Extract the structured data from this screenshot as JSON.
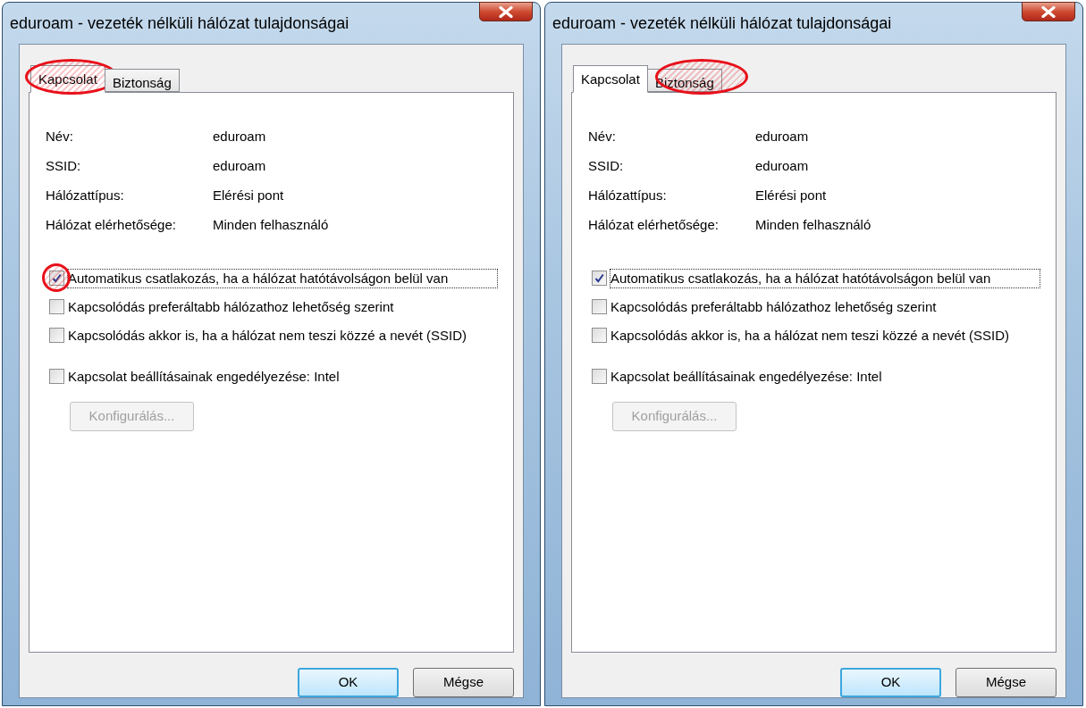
{
  "dialogs": [
    {
      "title": "eduroam - vezeték nélküli hálózat tulajdonságai",
      "tabs": [
        {
          "label": "Kapcsolat",
          "selected": true,
          "highlighted": true
        },
        {
          "label": "Biztonság",
          "selected": false,
          "highlighted": false
        }
      ],
      "fields": [
        {
          "label": "Név:",
          "value": "eduroam"
        },
        {
          "label": "SSID:",
          "value": "eduroam"
        },
        {
          "label": "Hálózattípus:",
          "value": "Elérési pont"
        },
        {
          "label": "Hálózat elérhetősége:",
          "value": "Minden felhasználó"
        }
      ],
      "checkboxes": [
        {
          "label": "Automatikus csatlakozás, ha a hálózat hatótávolságon belül van",
          "checked": true,
          "focused": true,
          "highlighted": true
        },
        {
          "label": "Kapcsolódás preferáltabb hálózathoz lehetőség szerint",
          "checked": false,
          "focused": false,
          "highlighted": false
        },
        {
          "label": "Kapcsolódás akkor is, ha a hálózat nem teszi közzé a nevét (SSID)",
          "checked": false,
          "focused": false,
          "highlighted": false
        },
        {
          "label": "Kapcsolat beállításainak engedélyezése: Intel",
          "checked": false,
          "focused": false,
          "highlighted": false
        }
      ],
      "configure_button": {
        "label": "Konfigurálás...",
        "disabled": true
      },
      "buttons": [
        {
          "label": "OK",
          "default": true
        },
        {
          "label": "Mégse",
          "default": false
        }
      ]
    },
    {
      "title": "eduroam - vezeték nélküli hálózat tulajdonságai",
      "tabs": [
        {
          "label": "Kapcsolat",
          "selected": true,
          "highlighted": false
        },
        {
          "label": "Biztonság",
          "selected": false,
          "highlighted": true
        }
      ],
      "fields": [
        {
          "label": "Név:",
          "value": "eduroam"
        },
        {
          "label": "SSID:",
          "value": "eduroam"
        },
        {
          "label": "Hálózattípus:",
          "value": "Elérési pont"
        },
        {
          "label": "Hálózat elérhetősége:",
          "value": "Minden felhasználó"
        }
      ],
      "checkboxes": [
        {
          "label": "Automatikus csatlakozás, ha a hálózat hatótávolságon belül van",
          "checked": true,
          "focused": true,
          "highlighted": false
        },
        {
          "label": "Kapcsolódás preferáltabb hálózathoz lehetőség szerint",
          "checked": false,
          "focused": false,
          "highlighted": false
        },
        {
          "label": "Kapcsolódás akkor is, ha a hálózat nem teszi közzé a nevét (SSID)",
          "checked": false,
          "focused": false,
          "highlighted": false
        },
        {
          "label": "Kapcsolat beállításainak engedélyezése: Intel",
          "checked": false,
          "focused": false,
          "highlighted": false
        }
      ],
      "configure_button": {
        "label": "Konfigurálás...",
        "disabled": true
      },
      "buttons": [
        {
          "label": "OK",
          "default": true
        },
        {
          "label": "Mégse",
          "default": false
        }
      ]
    }
  ]
}
